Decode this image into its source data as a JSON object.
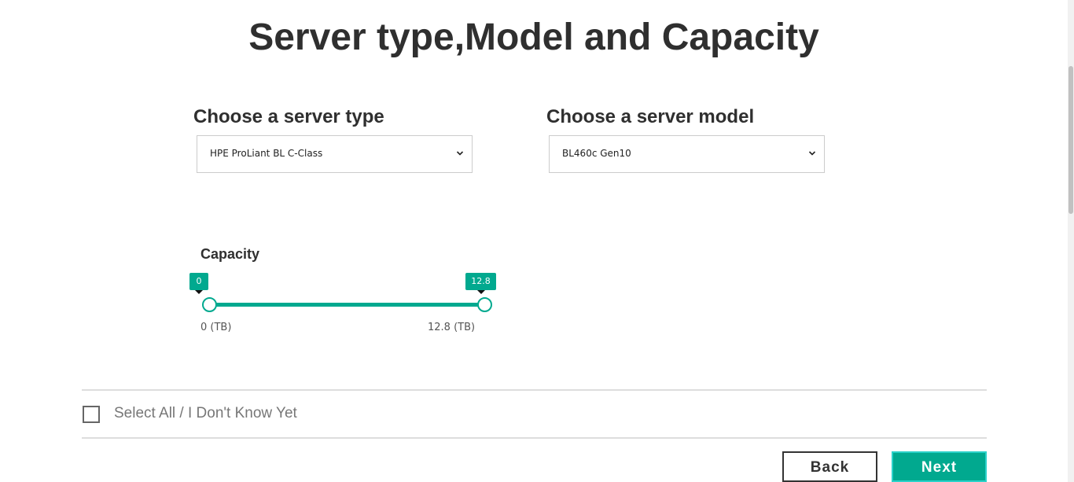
{
  "header": {
    "title": "Server type,Model and Capacity"
  },
  "server_type": {
    "label": "Choose a server type",
    "selected": "HPE ProLiant BL C-Class"
  },
  "server_model": {
    "label": "Choose a server model",
    "selected": "BL460c Gen10"
  },
  "capacity": {
    "label": "Capacity",
    "min_value": "0",
    "max_value": "12.8",
    "range_min_label": "0 (TB)",
    "range_max_label": "12.8 (TB)",
    "selected_min": 0,
    "selected_max": 12.8
  },
  "select_all": {
    "label": "Select All / I Don't Know Yet",
    "checked": false
  },
  "actions": {
    "back_label": "Back",
    "next_label": "Next"
  },
  "colors": {
    "accent": "#01a98f",
    "accent_border": "#2ad2c9",
    "text_dark": "#2f2f2f"
  },
  "icons": {
    "dropdown": "chevron-down-icon"
  }
}
